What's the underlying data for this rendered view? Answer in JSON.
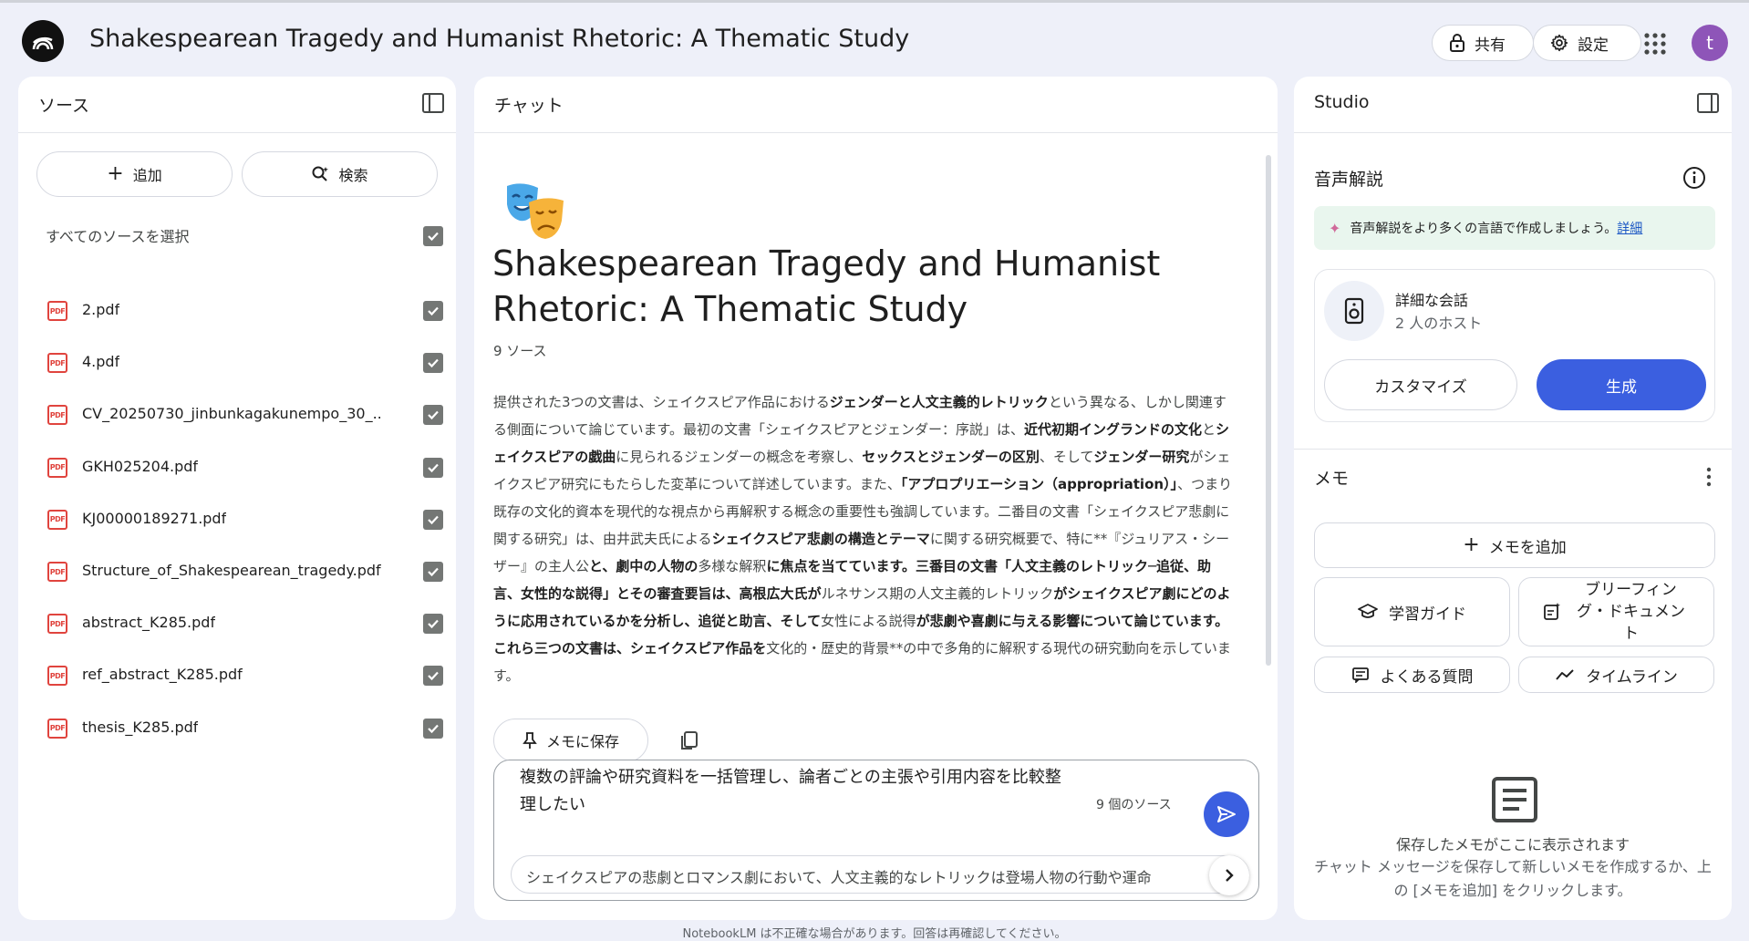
{
  "header": {
    "title": "Shakespearean Tragedy and Humanist Rhetoric: A Thematic Study",
    "share_label": "共有",
    "settings_label": "設定",
    "avatar_letter": "t"
  },
  "sources": {
    "title": "ソース",
    "add_label": "追加",
    "search_label": "検索",
    "select_all": "すべてのソースを選択",
    "items": [
      {
        "name": "2.pdf"
      },
      {
        "name": "4.pdf"
      },
      {
        "name": "CV_20250730_jinbunkagakunempo_30_..."
      },
      {
        "name": "GKH025204.pdf"
      },
      {
        "name": "KJ00000189271.pdf"
      },
      {
        "name": "Structure_of_Shakespearean_tragedy.pdf"
      },
      {
        "name": "abstract_K285.pdf"
      },
      {
        "name": "ref_abstract_K285.pdf"
      },
      {
        "name": "thesis_K285.pdf"
      }
    ],
    "pdf_badge": "PDF"
  },
  "chat": {
    "title": "チャット",
    "notebook_title": "Shakespearean Tragedy and Humanist Rhetoric: A Thematic Study",
    "source_count": "9 ソース",
    "summary": [
      {
        "t": "提供された3つの文書は、シェイクスピア作品における",
        "b": false
      },
      {
        "t": "ジェンダーと人文主義的レトリック",
        "b": true
      },
      {
        "t": "という異なる、しかし関連する側面について論じています。最初の文書「シェイクスピアとジェンダー：序説」は、",
        "b": false
      },
      {
        "t": "近代初期イングランドの文化",
        "b": true
      },
      {
        "t": "と",
        "b": false
      },
      {
        "t": "シェイクスピアの戯曲",
        "b": true
      },
      {
        "t": "に見られるジェンダーの概念を考察し、",
        "b": false
      },
      {
        "t": "セックスとジェンダーの区別",
        "b": true
      },
      {
        "t": "、そして",
        "b": false
      },
      {
        "t": "ジェンダー研究",
        "b": true
      },
      {
        "t": "がシェイクスピア研究にもたらした変革について詳述しています。また、",
        "b": false
      },
      {
        "t": "「アプロプリエーション（appropriation）」",
        "b": true
      },
      {
        "t": "、つまり既存の文化的資本を現代的な視点から再解釈する概念の重要性も強調しています。二番目の文書「シェイクスピア悲劇に関する研究」は、由井武夫氏による",
        "b": false
      },
      {
        "t": "シェイクスピア悲劇の構造とテーマ",
        "b": true
      },
      {
        "t": "に関する研究概要で、特に**『ジュリアス・シーザー』の主人公",
        "b": false
      },
      {
        "t": "と、劇中の人物の",
        "b": true
      },
      {
        "t": "多様な解釈",
        "b": false
      },
      {
        "t": "に焦点を当てています。三番目の文書「人文主義のレトリック─追従、助言、女性的な説得」とその審査要旨は、高根広大氏が",
        "b": true
      },
      {
        "t": "ルネサンス期の人文主義的レトリック",
        "b": false
      },
      {
        "t": "がシェイクスピア劇にどのように応用されているかを分析し、追従と助言、そして",
        "b": true
      },
      {
        "t": "女性による説得",
        "b": false
      },
      {
        "t": "が悲劇や喜劇に与える影響について論じています。これら三つの文書は、シェイクスピア作品を",
        "b": true
      },
      {
        "t": "文化的・歴史的背景**の中で多角的に解釈する現代の研究動向を示しています。",
        "b": false
      }
    ],
    "save_memo_label": "メモに保存",
    "composer_text": "複数の評論や研究資料を一括管理し、論者ごとの主張や引用内容を比較整理したい",
    "composer_source_count": "9 個のソース",
    "suggestion": "シェイクスピアの悲劇とロマンス劇において、人文主義的なレトリックは登場人物の行動や運命",
    "footer": "NotebookLM は不正確な場合があります。回答は再確認してください。"
  },
  "studio": {
    "title": "Studio",
    "audio_section": "音声解説",
    "banner_text": "音声解説をより多くの言語で作成しましょう。",
    "banner_link": "詳細",
    "audio_card_title": "詳細な会話",
    "audio_card_sub": "2 人のホスト",
    "customize_label": "カスタマイズ",
    "generate_label": "生成",
    "memo_section": "メモ",
    "add_memo_label": "メモを追加",
    "study_guide_label": "学習ガイド",
    "briefing_label": "ブリーフィング・ドキュメント",
    "faq_label": "よくある質問",
    "timeline_label": "タイムライン",
    "empty_title": "保存したメモがここに表示されます",
    "empty_desc": "チャット メッセージを保存して新しいメモを作成するか、上の [メモを追加] をクリックします。"
  },
  "colors": {
    "accent": "#3b5fe0",
    "avatar": "#8e55b8",
    "pdf_red": "#e0443e",
    "banner_bg": "#e9f6ee"
  }
}
